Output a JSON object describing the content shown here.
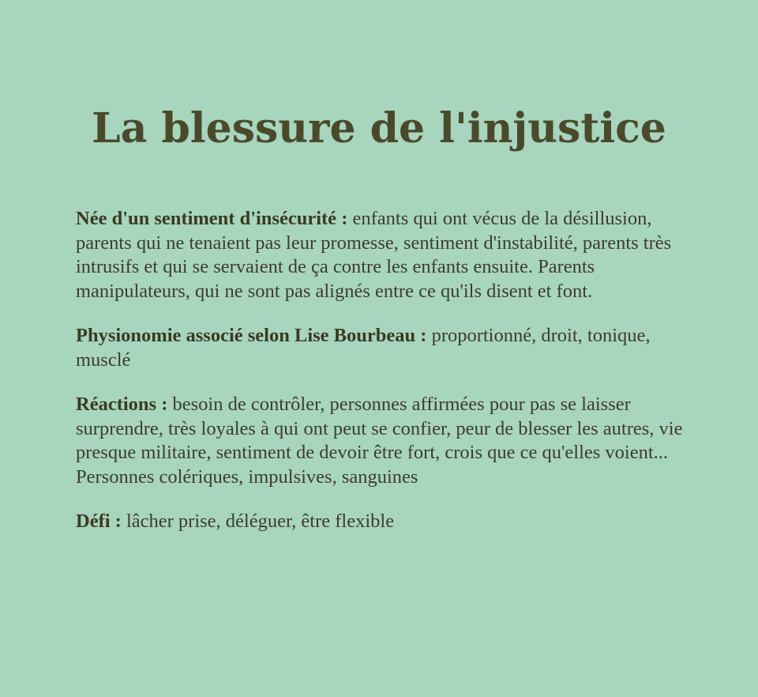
{
  "page": {
    "title": "La blessure de l'injustice",
    "background_color": "#a8d5be",
    "text_color": "#3d3d2c",
    "title_color": "#4a4a2a"
  },
  "sections": [
    {
      "label": "Née d'un sentiment d'insécurité",
      "separator": " : ",
      "text": "enfants qui ont vécus de la désillusion, parents qui ne tenaient pas leur promesse, sentiment d'instabilité, parents très intrusifs et qui se servaient de ça contre les enfants ensuite. Parents manipulateurs, qui ne sont pas alignés entre ce qu'ils disent et font."
    },
    {
      "label": "Physionomie associé selon Lise Bourbeau",
      "separator": " : ",
      "text": "proportionné, droit, tonique, musclé"
    },
    {
      "label": "Réactions",
      "separator": " : ",
      "text": "besoin de contrôler, personnes affirmées pour pas se laisser surprendre, très loyales à qui ont peut se confier, peur de blesser les autres, vie presque militaire, sentiment de devoir être fort, crois que ce qu'elles voient... Personnes colériques, impulsives, sanguines"
    },
    {
      "label": "Défi",
      "separator": " : ",
      "text": "lâcher prise, déléguer, être flexible"
    }
  ]
}
